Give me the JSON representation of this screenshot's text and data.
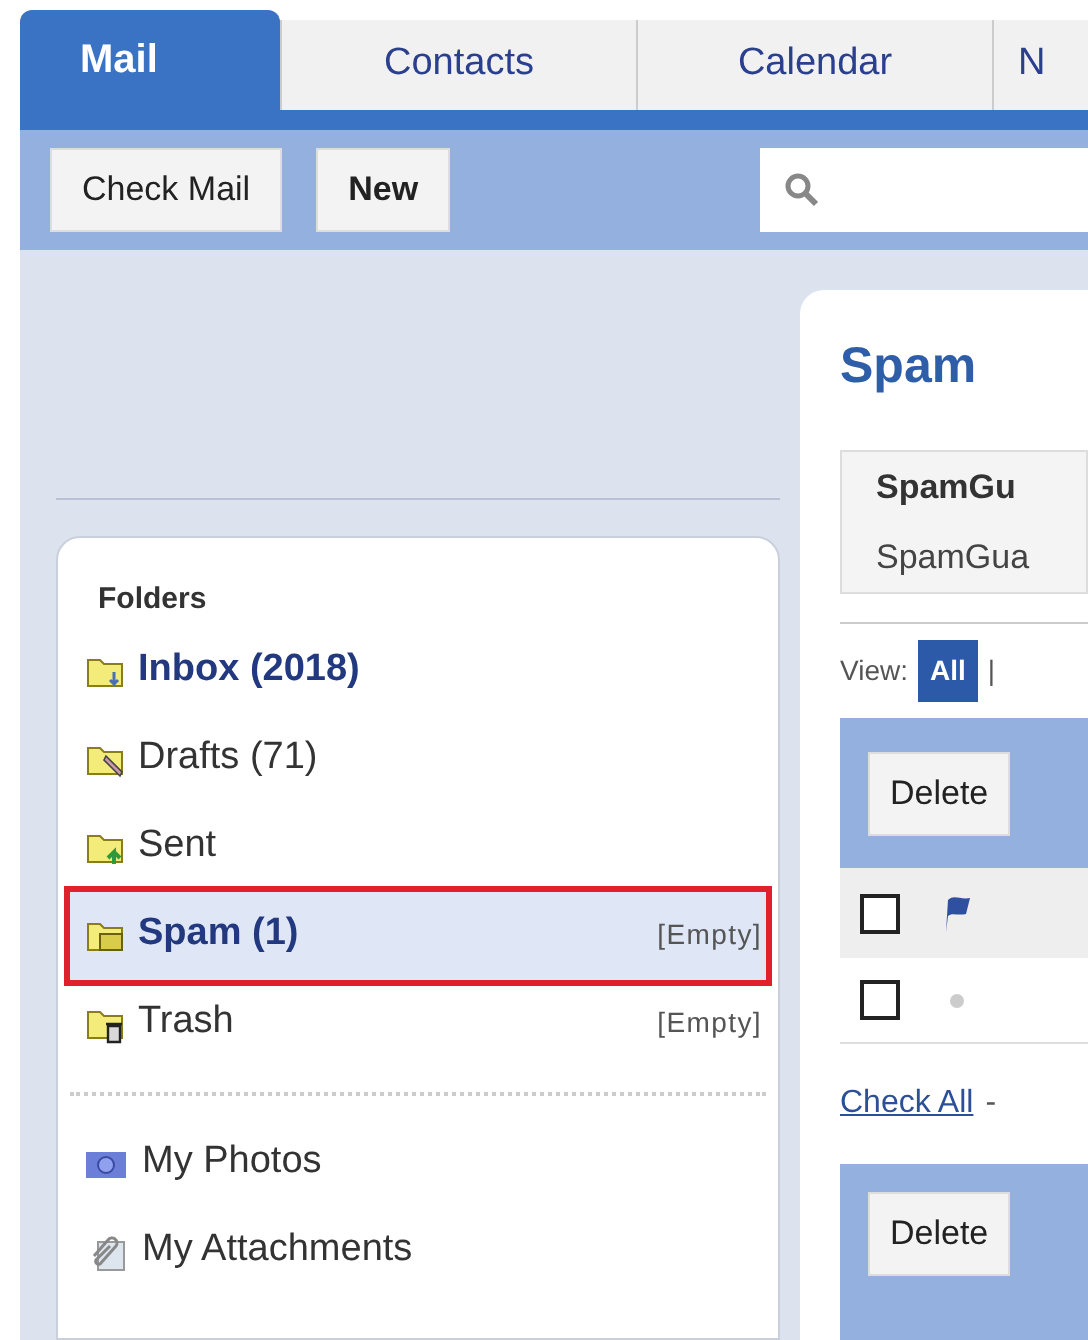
{
  "tabs": [
    {
      "label": "Mail",
      "selected": true
    },
    {
      "label": "Contacts",
      "selected": false
    },
    {
      "label": "Calendar",
      "selected": false
    },
    {
      "label": "N",
      "selected": false
    }
  ],
  "toolbar": {
    "buttons": [
      "Check Mail",
      "New"
    ]
  },
  "folders": {
    "heading": "Folders",
    "items": [
      {
        "kind": "inbox",
        "name": "Inbox (2018)",
        "unread": true,
        "selected": false
      },
      {
        "kind": "drafts",
        "name": "Drafts (71)",
        "unread": false,
        "selected": false
      },
      {
        "kind": "sent",
        "name": "Sent",
        "unread": false,
        "selected": false
      },
      {
        "kind": "spam",
        "name": "Spam (1)",
        "unread": true,
        "selected": true,
        "action": "[Empty]"
      },
      {
        "kind": "trash",
        "name": "Trash",
        "unread": false,
        "selected": false,
        "action": "[Empty]"
      }
    ],
    "extras": [
      {
        "kind": "photos",
        "name": "My Photos"
      },
      {
        "kind": "attachments",
        "name": "My Attachments"
      }
    ]
  },
  "main": {
    "title": "Spam",
    "notice": {
      "title": "SpamGu",
      "text": "SpamGua"
    },
    "view": {
      "label": "View:",
      "options": [
        {
          "label": "All",
          "selected": true
        }
      ],
      "separator": "|"
    },
    "delete_buttons": [
      "Delete",
      "Delete"
    ],
    "table": {
      "header_checked": false,
      "rows": [
        {
          "checked": false
        }
      ]
    },
    "check_all": "Check All",
    "check_all_suffix": "-"
  }
}
